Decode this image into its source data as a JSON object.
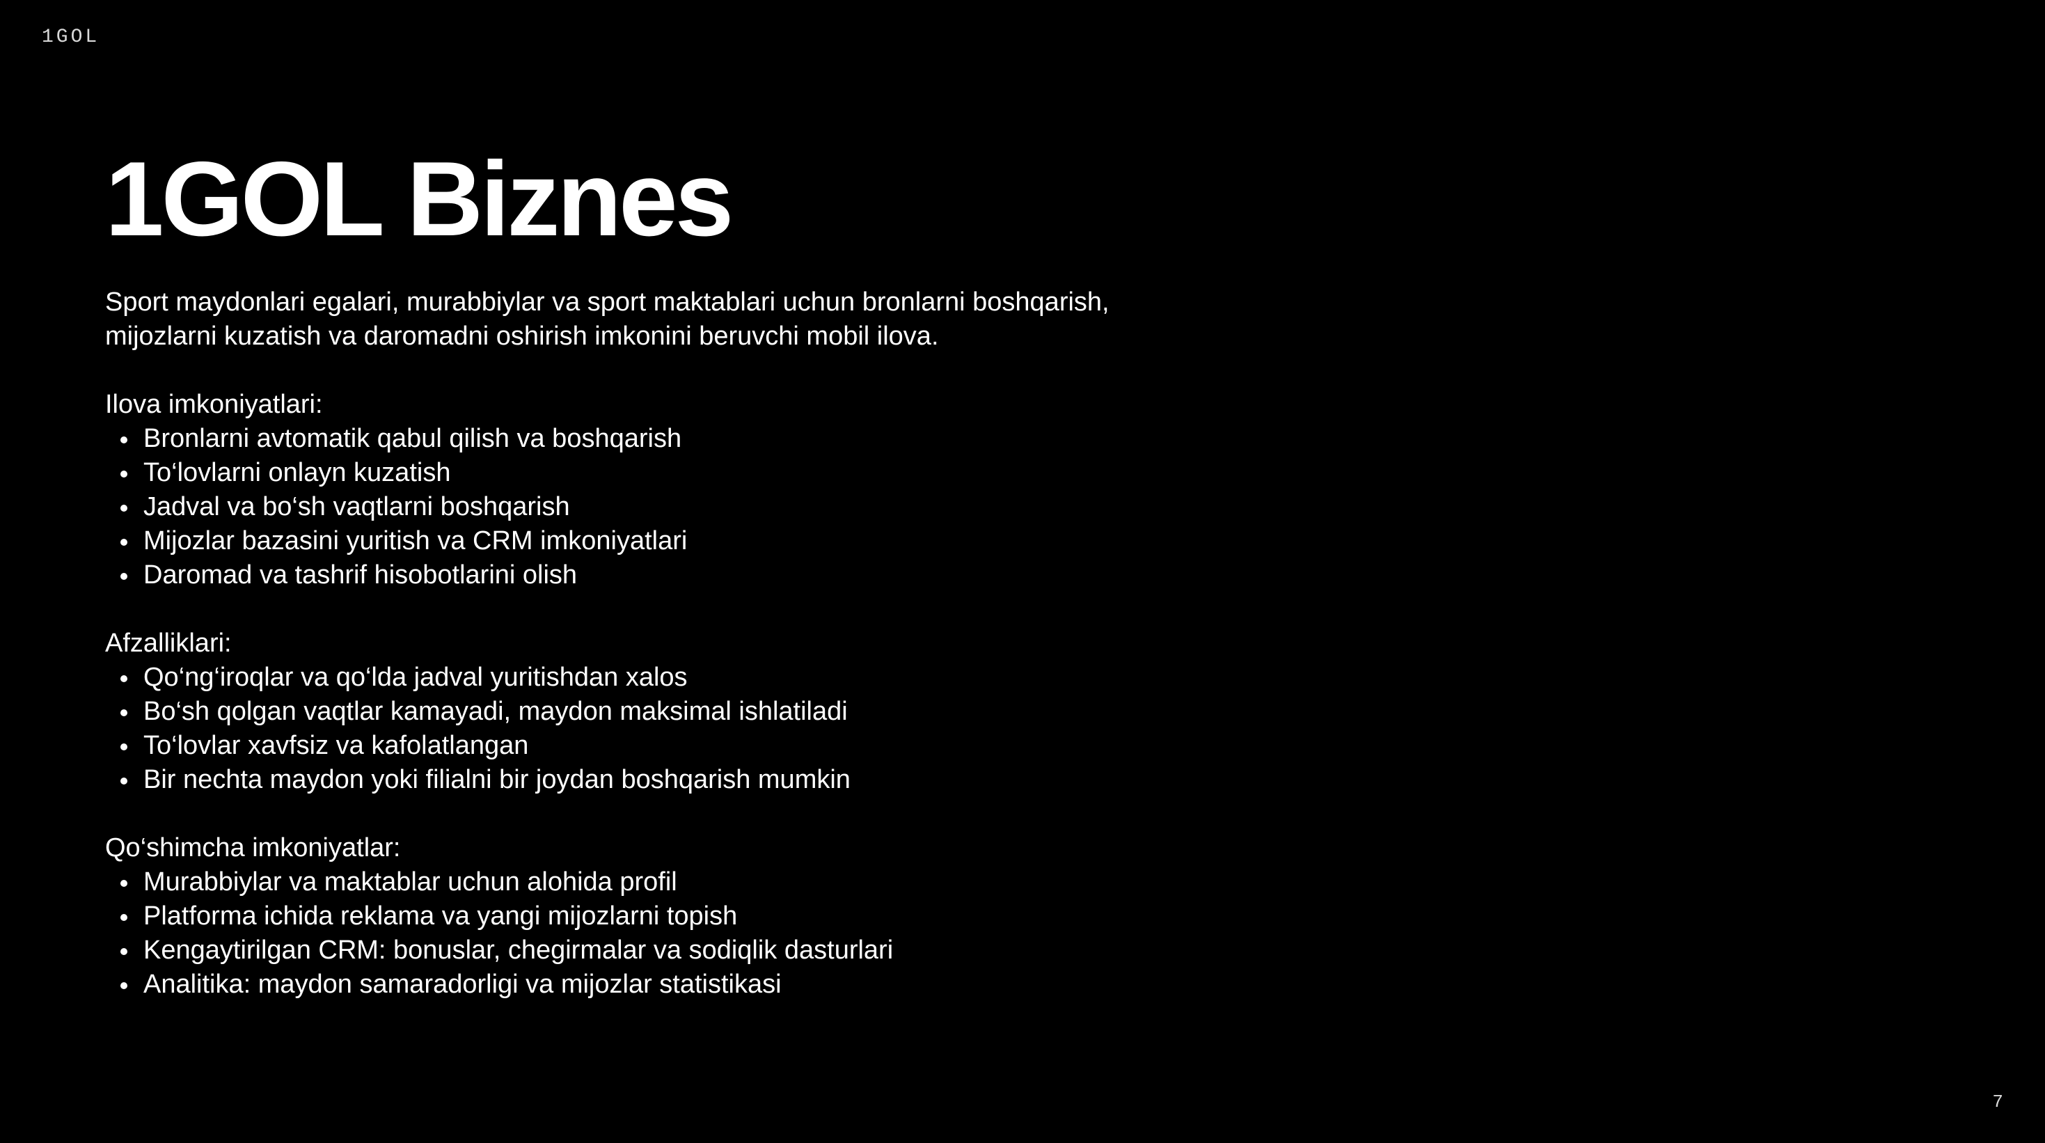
{
  "header": {
    "brand": "1GOL"
  },
  "slide": {
    "title": "1GOL Biznes",
    "intro_line_1": "Sport maydonlari egalari, murabbiylar va sport maktablari uchun bronlarni boshqarish,",
    "intro_line_2": "mijozlarni kuzatish va daromadni oshirish imkonini beruvchi mobil ilova.",
    "sections": [
      {
        "heading": "Ilova imkoniyatlari:",
        "items": [
          "Bronlarni avtomatik qabul qilish va boshqarish",
          "To‘lovlarni onlayn kuzatish",
          "Jadval va bo‘sh vaqtlarni boshqarish",
          "Mijozlar bazasini yuritish va CRM imkoniyatlari",
          "Daromad va tashrif hisobotlarini olish"
        ]
      },
      {
        "heading": "Afzalliklari:",
        "items": [
          "Qo‘ng‘iroqlar va qo‘lda jadval yuritishdan xalos",
          "Bo‘sh qolgan vaqtlar kamayadi, maydon maksimal ishlatiladi",
          "To‘lovlar xavfsiz va kafolatlangan",
          "Bir nechta maydon yoki filialni bir joydan boshqarish mumkin"
        ]
      },
      {
        "heading": "Qo‘shimcha imkoniyatlar:",
        "items": [
          "Murabbiylar va maktablar uchun alohida profil",
          "Platforma ichida reklama va yangi mijozlarni topish",
          "Kengaytirilgan CRM: bonuslar, chegirmalar va sodiqlik dasturlari",
          "Analitika: maydon samaradorligi va mijozlar statistikasi"
        ]
      }
    ]
  },
  "footer": {
    "page_number": "7"
  },
  "colors": {
    "background": "#000000",
    "text": "#ffffff"
  }
}
